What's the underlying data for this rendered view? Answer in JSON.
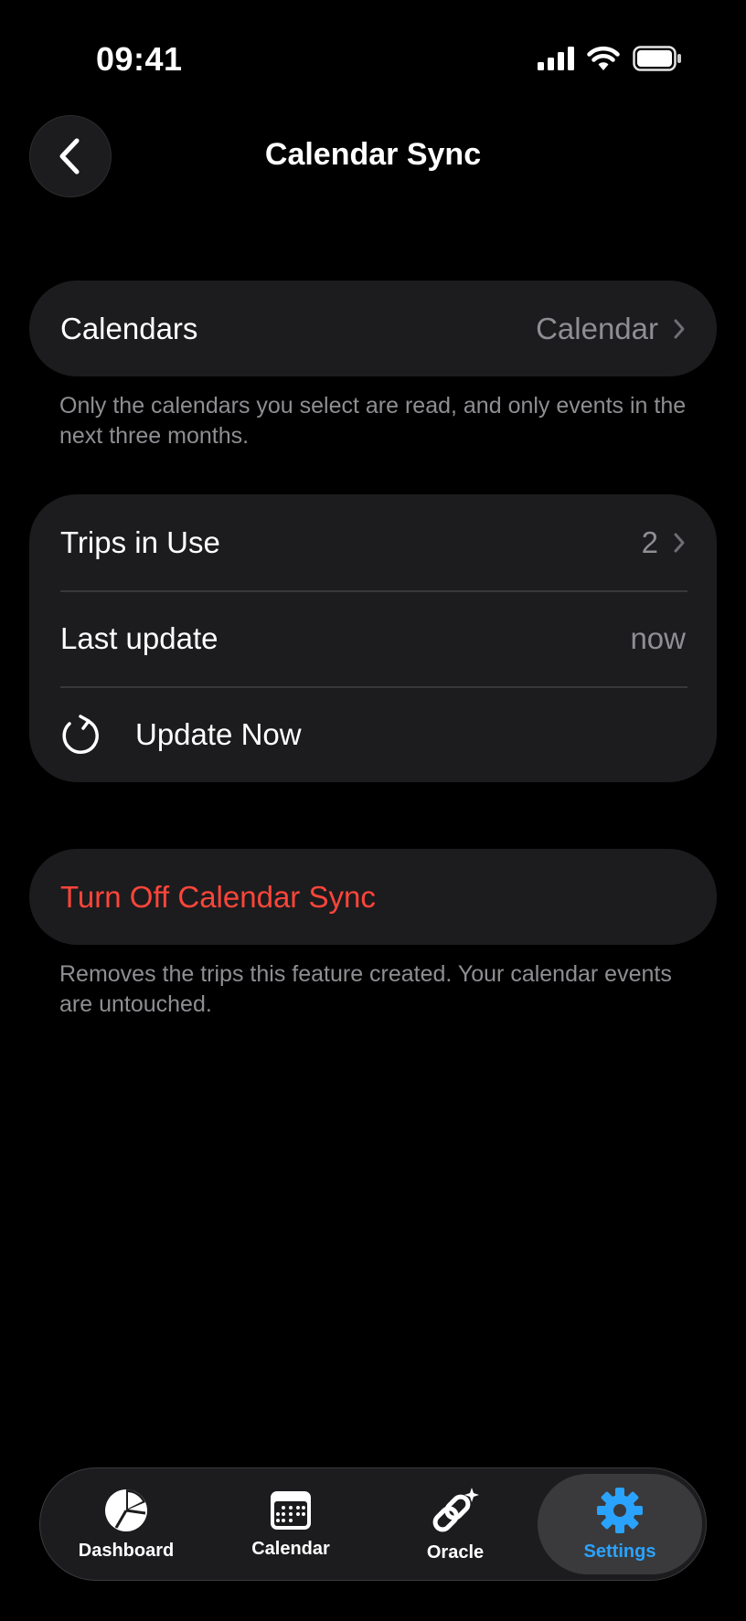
{
  "status_bar": {
    "time": "09:41"
  },
  "nav": {
    "title": "Calendar Sync"
  },
  "calendars_group": {
    "label": "Calendars",
    "value": "Calendar",
    "footnote": "Only the calendars you select are read, and only events in the next three months."
  },
  "sync_group": {
    "trips_label": "Trips in Use",
    "trips_value": "2",
    "last_update_label": "Last update",
    "last_update_value": "now",
    "update_now_label": "Update Now"
  },
  "danger_group": {
    "turn_off_label": "Turn Off Calendar Sync",
    "footnote": "Removes the trips this feature created. Your calendar events are untouched."
  },
  "tab_bar": {
    "tabs": [
      {
        "label": "Dashboard",
        "icon": "pie-chart-icon"
      },
      {
        "label": "Calendar",
        "icon": "calendar-icon"
      },
      {
        "label": "Oracle",
        "icon": "oracle-link-sparkle-icon"
      },
      {
        "label": "Settings",
        "icon": "gear-icon",
        "active": true
      }
    ]
  },
  "colors": {
    "background": "#000000",
    "card": "#1c1c1e",
    "secondary_text": "#8e8e93",
    "destructive": "#ff453a",
    "accent": "#2aa3ff"
  }
}
